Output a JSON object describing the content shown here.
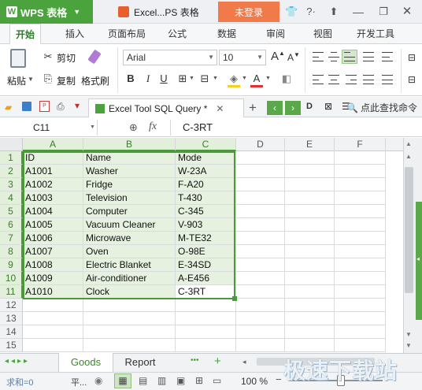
{
  "titlebar": {
    "app_name": "WPS 表格",
    "doc_title": "Excel...PS 表格",
    "login_label": "未登录",
    "accent": "#4aa33c",
    "login_color": "#f07a4a"
  },
  "ribbon_tabs": [
    "开始",
    "插入",
    "页面布局",
    "公式",
    "数据",
    "审阅",
    "视图",
    "开发工具"
  ],
  "ribbon": {
    "paste_label": "粘贴",
    "cut_label": "剪切",
    "copy_label": "复制",
    "format_painter_label": "格式刷",
    "font_name": "Arial",
    "font_size": "10",
    "grow_font": "A",
    "shrink_font": "A",
    "bold": "B",
    "italic": "I",
    "underline": "U",
    "font_color_letter": "A"
  },
  "quickbar": {
    "active_tab_label": "Excel Tool SQL Query *",
    "add_label": "+",
    "find_command_label": "点此查找命令"
  },
  "formula_bar": {
    "cell_ref": "C11",
    "fx_label": "fx",
    "content": "C-3RT"
  },
  "grid": {
    "columns": [
      "A",
      "B",
      "C",
      "D",
      "E",
      "F"
    ],
    "row_numbers": [
      "1",
      "2",
      "3",
      "4",
      "5",
      "6",
      "7",
      "8",
      "9",
      "10",
      "11",
      "12",
      "13",
      "14",
      "15"
    ],
    "rows": [
      [
        "ID",
        "Name",
        "Mode"
      ],
      [
        "A1001",
        "Washer",
        "W-23A"
      ],
      [
        "A1002",
        "Fridge",
        "F-A20"
      ],
      [
        "A1003",
        "Television",
        "T-430"
      ],
      [
        "A1004",
        "Computer",
        "C-345"
      ],
      [
        "A1005",
        "Vacuum Cleaner",
        "V-903"
      ],
      [
        "A1006",
        "Microwave",
        "M-TE32"
      ],
      [
        "A1007",
        "Oven",
        "O-98E"
      ],
      [
        "A1008",
        "Electric Blanket",
        "E-34SD"
      ],
      [
        "A1009",
        "Air-conditioner",
        "A-E456"
      ],
      [
        "A1010",
        "Clock",
        "C-3RT"
      ]
    ]
  },
  "sheets": {
    "tabs": [
      "Goods",
      "Report"
    ],
    "active": "Goods",
    "more": "•••",
    "add": "+"
  },
  "status": {
    "sum_label": "求和=0",
    "avg_label": "平...",
    "zoom_label": "100 %",
    "zoom_level": 100,
    "zoom_minus": "−",
    "zoom_plus": "+"
  },
  "watermark": "极速下载站"
}
